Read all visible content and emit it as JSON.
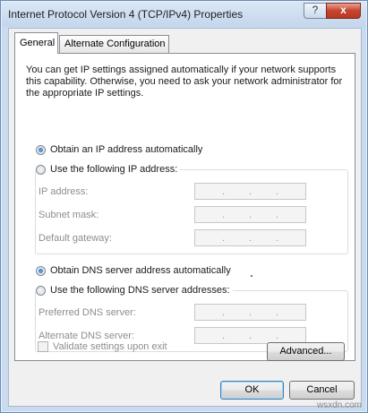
{
  "window": {
    "title": "Internet Protocol Version 4 (TCP/IPv4) Properties",
    "help_label": "?",
    "close_label": "x"
  },
  "tabs": [
    {
      "label": "General",
      "active": true
    },
    {
      "label": "Alternate Configuration",
      "active": false
    }
  ],
  "description": "You can get IP settings assigned automatically if your network supports this capability. Otherwise, you need to ask your network administrator for the appropriate IP settings.",
  "ip": {
    "auto_label": "Obtain an IP address automatically",
    "manual_label": "Use the following IP address:",
    "selected": "auto",
    "fields": [
      {
        "label": "IP address:",
        "value": ""
      },
      {
        "label": "Subnet mask:",
        "value": ""
      },
      {
        "label": "Default gateway:",
        "value": ""
      }
    ]
  },
  "dns": {
    "auto_label": "Obtain DNS server address automatically",
    "manual_label": "Use the following DNS server addresses:",
    "selected": "auto",
    "fields": [
      {
        "label": "Preferred DNS server:",
        "value": ""
      },
      {
        "label": "Alternate DNS server:",
        "value": ""
      }
    ]
  },
  "validate_label": "Validate settings upon exit",
  "buttons": {
    "advanced": "Advanced...",
    "ok": "OK",
    "cancel": "Cancel"
  },
  "watermark": "wsxdn.com",
  "ip_dot": "."
}
